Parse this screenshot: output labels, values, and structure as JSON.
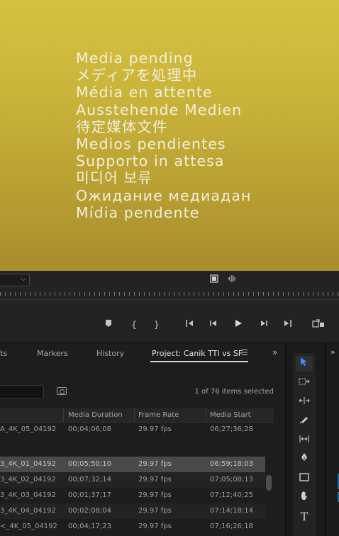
{
  "monitor": {
    "pending_lines": [
      "Media pending",
      "メディアを処理中",
      "Média en attente",
      "Ausstehende Medien",
      "待定媒体文件",
      "Medios pendientes",
      "Supporto in attesa",
      "미디어 보류",
      "Ожидание медиадан",
      "Mídia pendente"
    ]
  },
  "transport_icons": [
    "marker-icon",
    "mark-in-icon",
    "mark-out-icon",
    "go-to-in-icon",
    "step-back-icon",
    "play-icon",
    "step-forward-icon",
    "go-to-out-icon",
    "export-frame-icon"
  ],
  "panel_tabs": {
    "tab_partial": "ts",
    "markers": "Markers",
    "history": "History",
    "project": "Project: Canik TTI vs SF",
    "menu_glyph": "☰",
    "overflow_glyph": "»"
  },
  "project": {
    "items_selected": "1 of 76 items selected",
    "columns": {
      "name": "",
      "media_duration": "Media Duration",
      "frame_rate": "Frame Rate",
      "media_start": "Media Start"
    },
    "rows": [
      {
        "name": "A_4K_05_04192",
        "duration": "00;04;06;08",
        "fps": "29.97 fps",
        "start": "06;27;36;28",
        "style": ""
      },
      {
        "name": "",
        "duration": "",
        "fps": "",
        "start": "",
        "style": ""
      },
      {
        "name": "3_4K_01_04192",
        "duration": "00;05;50;10",
        "fps": "29.97 fps",
        "start": "06;59;18;03",
        "style": "sel"
      },
      {
        "name": "3_4K_02_04192",
        "duration": "00;07;32;14",
        "fps": "29.97 fps",
        "start": "07;05;08;13",
        "style": "alt"
      },
      {
        "name": "3_4K_03_04192",
        "duration": "00;01;37;17",
        "fps": "29.97 fps",
        "start": "07;12;40;25",
        "style": ""
      },
      {
        "name": "3_4K_04_04192",
        "duration": "00;02;08;04",
        "fps": "29.97 fps",
        "start": "07;14;18;14",
        "style": "alt"
      },
      {
        "name": "<_4K_05_04192",
        "duration": "00;04;17;23",
        "fps": "29.97 fps",
        "start": "07;16;26;18",
        "style": ""
      }
    ]
  },
  "tools": [
    "selection-tool",
    "track-select-tool",
    "ripple-edit-tool",
    "razor-tool",
    "slip-tool",
    "pen-tool",
    "rectangle-tool",
    "hand-tool",
    "type-tool"
  ],
  "tool_glyphs": {
    "type": "T"
  },
  "colors": {
    "monitor_bg": "#c9b43a",
    "accent_blue": "#3f8dff",
    "panel_bg": "#1d1d1d"
  }
}
